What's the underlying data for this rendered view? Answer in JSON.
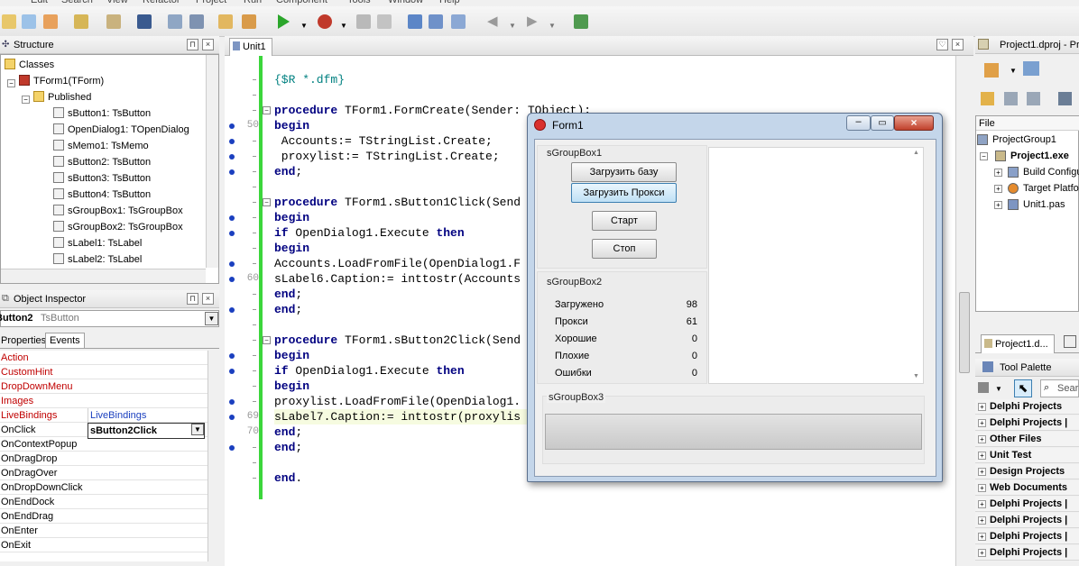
{
  "menu": [
    "Edit",
    "Search",
    "View",
    "Refactor",
    "Project",
    "Run",
    "Component",
    "Tools",
    "Window",
    "Help"
  ],
  "structure": {
    "title": "Structure",
    "items": [
      {
        "label": "Classes",
        "icon": "folder-icon"
      },
      {
        "label": "TForm1(TForm)",
        "icon": "class-icon"
      },
      {
        "label": "Published",
        "icon": "folder-icon"
      },
      {
        "label": "sButton1: TsButton",
        "icon": "field-icon"
      },
      {
        "label": "OpenDialog1: TOpenDialog",
        "icon": "field-icon"
      },
      {
        "label": "sMemo1: TsMemo",
        "icon": "field-icon"
      },
      {
        "label": "sButton2: TsButton",
        "icon": "field-icon"
      },
      {
        "label": "sButton3: TsButton",
        "icon": "field-icon"
      },
      {
        "label": "sButton4: TsButton",
        "icon": "field-icon"
      },
      {
        "label": "sGroupBox1: TsGroupBox",
        "icon": "field-icon"
      },
      {
        "label": "sGroupBox2: TsGroupBox",
        "icon": "field-icon"
      },
      {
        "label": "sLabel1: TsLabel",
        "icon": "field-icon"
      },
      {
        "label": "sLabel2: TsLabel",
        "icon": "field-icon"
      }
    ]
  },
  "inspector": {
    "title": "Object Inspector",
    "selected_name": "Button2",
    "selected_type": "TsButton",
    "tabs": [
      "Properties",
      "Events"
    ],
    "rows": [
      {
        "k": "Action",
        "v": "",
        "red": true
      },
      {
        "k": "CustomHint",
        "v": "",
        "red": true
      },
      {
        "k": "DropDownMenu",
        "v": "",
        "red": true
      },
      {
        "k": "Images",
        "v": "",
        "red": true
      },
      {
        "k": "LiveBindings",
        "v": "LiveBindings",
        "red": true
      },
      {
        "k": "OnClick",
        "v": "sButton2Click",
        "red": false
      },
      {
        "k": "OnContextPopup",
        "v": "",
        "red": false
      },
      {
        "k": "OnDragDrop",
        "v": "",
        "red": false
      },
      {
        "k": "OnDragOver",
        "v": "",
        "red": false
      },
      {
        "k": "OnDropDownClick",
        "v": "",
        "red": false
      },
      {
        "k": "OnEndDock",
        "v": "",
        "red": false
      },
      {
        "k": "OnEndDrag",
        "v": "",
        "red": false
      },
      {
        "k": "OnEnter",
        "v": "",
        "red": false
      },
      {
        "k": "OnExit",
        "v": "",
        "red": false
      }
    ]
  },
  "editor": {
    "tab": "Unit1",
    "lines": [
      {
        "n": "",
        "dot": false,
        "html": "<span class='cm'>{$R *.dfm}</span>"
      },
      {
        "n": "",
        "dot": false,
        "html": ""
      },
      {
        "n": "",
        "dot": false,
        "fold": true,
        "html": "<span class='kw'>procedure</span> TForm1.FormCreate(Sender: TObject);"
      },
      {
        "n": "50",
        "dot": true,
        "html": "<span class='kw'>begin</span>"
      },
      {
        "n": "",
        "dot": true,
        "html": " Accounts:= TStringList.Create;"
      },
      {
        "n": "",
        "dot": true,
        "html": " proxylist:= TStringList.Create;"
      },
      {
        "n": "",
        "dot": true,
        "html": "<span class='kw'>end</span>;"
      },
      {
        "n": "",
        "dot": false,
        "html": ""
      },
      {
        "n": "",
        "dot": false,
        "fold": true,
        "html": "<span class='kw'>procedure</span> TForm1.sButton1Click(Send"
      },
      {
        "n": "",
        "dot": true,
        "html": "<span class='kw'>begin</span>"
      },
      {
        "n": "",
        "dot": true,
        "html": "<span class='kw'>if</span> OpenDialog1.Execute <span class='kw'>then</span>"
      },
      {
        "n": "",
        "dot": false,
        "html": "<span class='kw'>begin</span>"
      },
      {
        "n": "",
        "dot": true,
        "html": "Accounts.LoadFromFile(OpenDialog1.F"
      },
      {
        "n": "60",
        "dot": true,
        "html": "sLabel6.Caption:= inttostr(Accounts"
      },
      {
        "n": "",
        "dot": false,
        "html": "<span class='kw'>end</span>;"
      },
      {
        "n": "",
        "dot": true,
        "html": "<span class='kw'>end</span>;"
      },
      {
        "n": "",
        "dot": false,
        "html": ""
      },
      {
        "n": "",
        "dot": false,
        "fold": true,
        "html": "<span class='kw'>procedure</span> TForm1.sButton2Click(Send"
      },
      {
        "n": "",
        "dot": true,
        "html": "<span class='kw'>begin</span>"
      },
      {
        "n": "",
        "dot": true,
        "html": "<span class='kw'>if</span> OpenDialog1.Execute <span class='kw'>then</span>"
      },
      {
        "n": "",
        "dot": false,
        "html": "<span class='kw'>begin</span>"
      },
      {
        "n": "",
        "dot": true,
        "html": "proxylist.LoadFromFile(OpenDialog1."
      },
      {
        "n": "69",
        "dot": true,
        "html": "sLabel7.Caption:= inttostr(proxylis"
      },
      {
        "n": "70",
        "dot": false,
        "html": "<span class='kw'>end</span>;"
      },
      {
        "n": "",
        "dot": true,
        "html": "<span class='kw'>end</span>;"
      },
      {
        "n": "",
        "dot": false,
        "html": ""
      },
      {
        "n": "",
        "dot": false,
        "html": "<span class='kw'>end</span>."
      }
    ]
  },
  "form": {
    "title": "Form1",
    "group1": "sGroupBox1",
    "group2": "sGroupBox2",
    "group3": "sGroupBox3",
    "btn_load_base": "Загрузить базу",
    "btn_load_proxy": "Загрузить Прокси",
    "btn_start": "Старт",
    "btn_stop": "Стоп",
    "stats": [
      {
        "label": "Загружено",
        "value": "98"
      },
      {
        "label": "Прокси",
        "value": "61"
      },
      {
        "label": "Хорошие",
        "value": "0"
      },
      {
        "label": "Плохие",
        "value": "0"
      },
      {
        "label": "Ошибки",
        "value": "0"
      }
    ]
  },
  "project": {
    "title": "Project1.dproj - Pr",
    "file_header": "File",
    "items": [
      {
        "label": "ProjectGroup1",
        "bold": false
      },
      {
        "label": "Project1.exe",
        "bold": true
      },
      {
        "label": "Build Configu",
        "bold": false
      },
      {
        "label": "Target Platfo",
        "bold": false
      },
      {
        "label": "Unit1.pas",
        "bold": false
      }
    ],
    "tab": "Project1.d..."
  },
  "palette": {
    "title": "Tool Palette",
    "search_placeholder": "Sear",
    "categories": [
      "Delphi Projects",
      "Delphi Projects | ",
      "Other Files",
      "Unit Test",
      "Design Projects",
      "Web Documents",
      "Delphi Projects | ",
      "Delphi Projects | ",
      "Delphi Projects | ",
      "Delphi Projects | "
    ]
  },
  "colors": {
    "accent": "#1a3fbf",
    "keyword": "#000080",
    "event_red": "#c00000",
    "change_bar": "#3bd63b"
  }
}
